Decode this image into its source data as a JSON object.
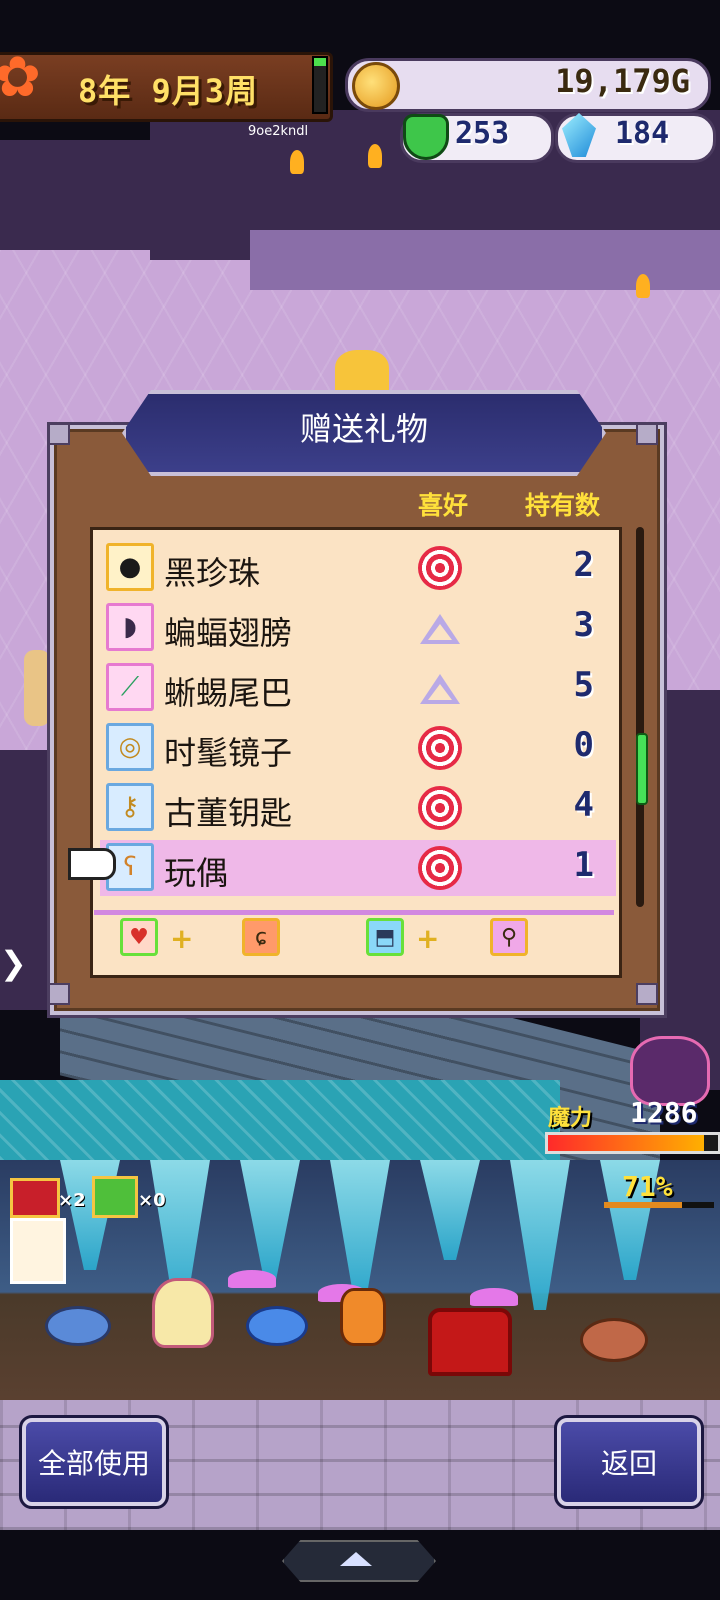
{
  "hud": {
    "date": "8年 9月3周",
    "gold": "19,179G",
    "monsters": "253",
    "crystals": "184",
    "code": "9oe2kndl"
  },
  "dialog": {
    "title": "赠送礼物",
    "col_pref": "喜好",
    "col_owned": "持有数",
    "items": [
      {
        "name": "黑珍珠",
        "pref": "love",
        "count": "2",
        "color": "#f0b32a",
        "icon": "black-pearl-icon"
      },
      {
        "name": "蝙蝠翅膀",
        "pref": "like",
        "count": "3",
        "color": "#e67ad0",
        "icon": "bat-wing-icon"
      },
      {
        "name": "蜥蜴尾巴",
        "pref": "like",
        "count": "5",
        "color": "#e67ad0",
        "icon": "lizard-tail-icon"
      },
      {
        "name": "时髦镜子",
        "pref": "love",
        "count": "0",
        "color": "#6aa8e0",
        "icon": "mirror-icon"
      },
      {
        "name": "古董钥匙",
        "pref": "love",
        "count": "4",
        "color": "#6aa8e0",
        "icon": "antique-key-icon"
      },
      {
        "name": "玩偶",
        "pref": "love",
        "count": "1",
        "color": "#6aa8e0",
        "icon": "doll-icon",
        "selected": true
      }
    ],
    "stat_icons": [
      "heart-stat-icon",
      "strength-stat-icon",
      "shield-stat-icon",
      "wand-stat-icon"
    ],
    "plus": "+"
  },
  "boss": {
    "mana_label": "魔力",
    "mana_value": "1286",
    "mana_level": 0.92
  },
  "inventory": {
    "chests": "×2",
    "gifts": "×0",
    "percent": "71%",
    "percent_level": 0.71
  },
  "buttons": {
    "use_all": "全部使用",
    "back": "返回"
  },
  "colors": {
    "accent_yellow": "#ffe13b",
    "dialog_brown": "#8a5a3a",
    "list_bg": "#fbe3c4",
    "selected_row": "#efb8e8",
    "button_blue": "#2a2a78"
  }
}
